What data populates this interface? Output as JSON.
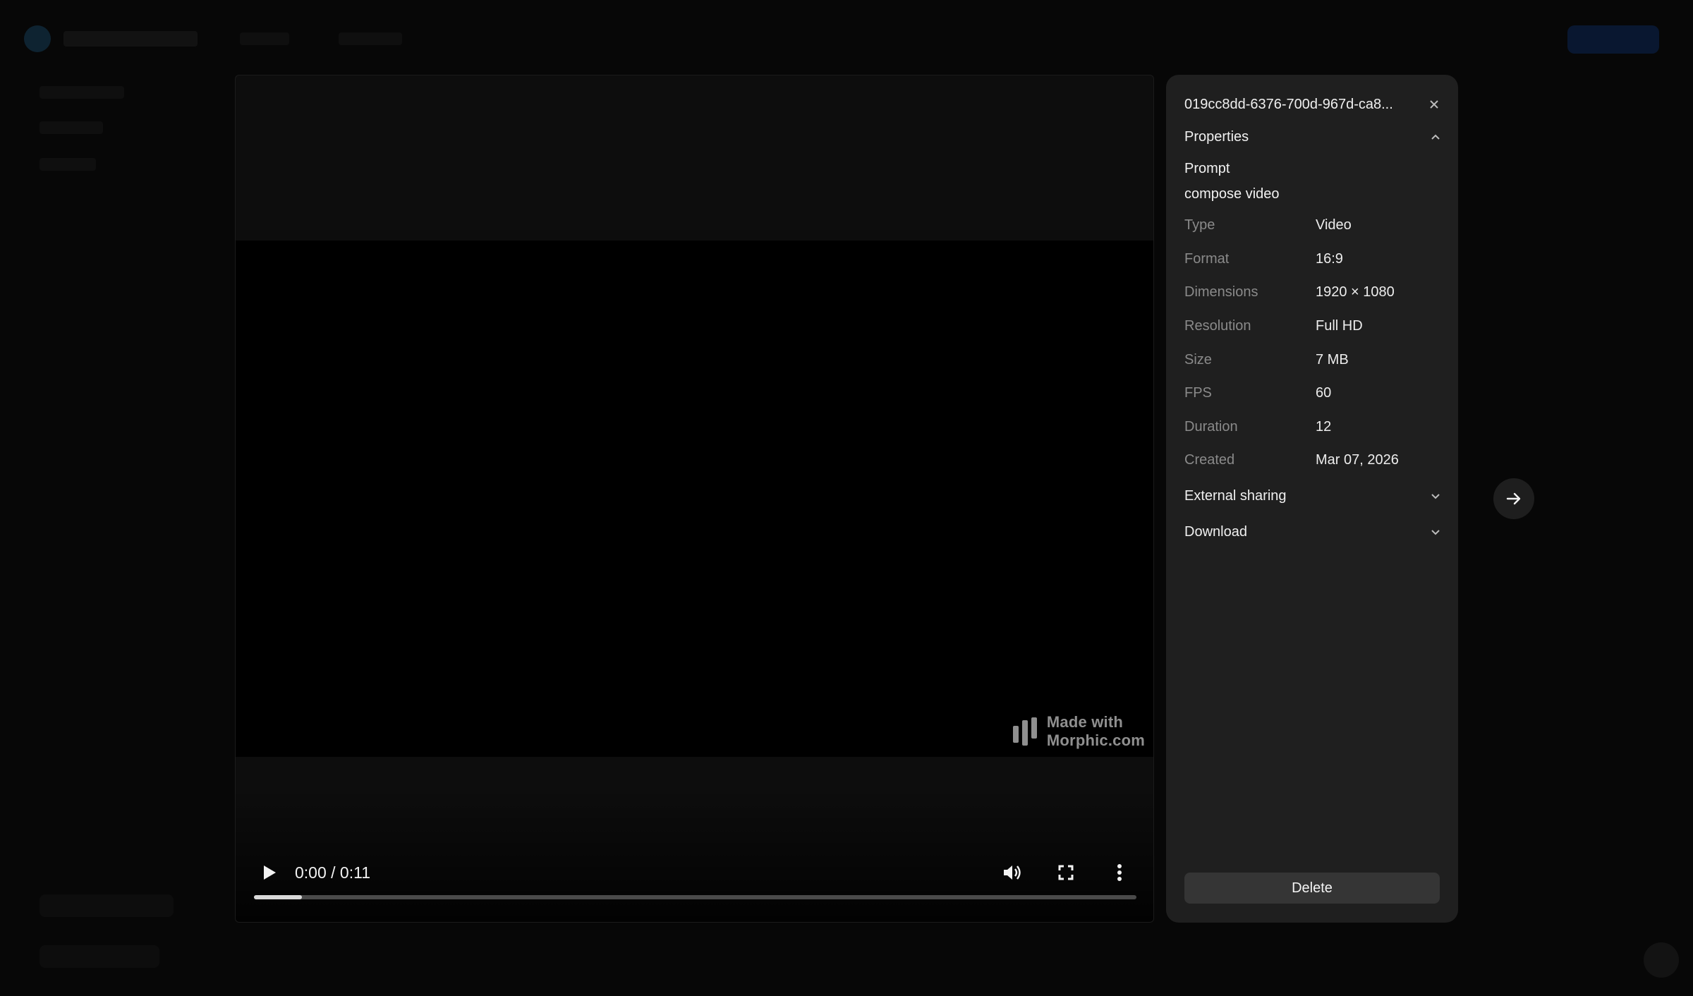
{
  "video": {
    "time_display": "0:00 / 0:11",
    "progress": 0.054,
    "watermark": {
      "line1": "Made with",
      "line2": "Morphic.com"
    }
  },
  "details": {
    "title": "019cc8dd-6376-700d-967d-ca8...",
    "properties_label": "Properties",
    "prompt_label": "Prompt",
    "prompt_value": "compose video",
    "rows": [
      {
        "key": "Type",
        "value": "Video"
      },
      {
        "key": "Format",
        "value": "16:9"
      },
      {
        "key": "Dimensions",
        "value": "1920 × 1080"
      },
      {
        "key": "Resolution",
        "value": "Full HD"
      },
      {
        "key": "Size",
        "value": "7 MB"
      },
      {
        "key": "FPS",
        "value": "60"
      },
      {
        "key": "Duration",
        "value": "12"
      },
      {
        "key": "Created",
        "value": "Mar 07, 2026"
      }
    ],
    "external_sharing_label": "External sharing",
    "download_label": "Download",
    "delete_label": "Delete"
  },
  "icons": {
    "play": "play-icon",
    "volume": "volume-icon",
    "fullscreen": "fullscreen-icon",
    "more": "more-vertical-icon",
    "close": "close-icon",
    "chevron_up": "chevron-up-icon",
    "chevron_down": "chevron-down-icon",
    "arrow_right": "arrow-right-icon"
  },
  "colors": {
    "background": "#070707",
    "panel": "#1f1f1f",
    "delete_button": "#353535",
    "muted_text": "#8a8a8a"
  }
}
